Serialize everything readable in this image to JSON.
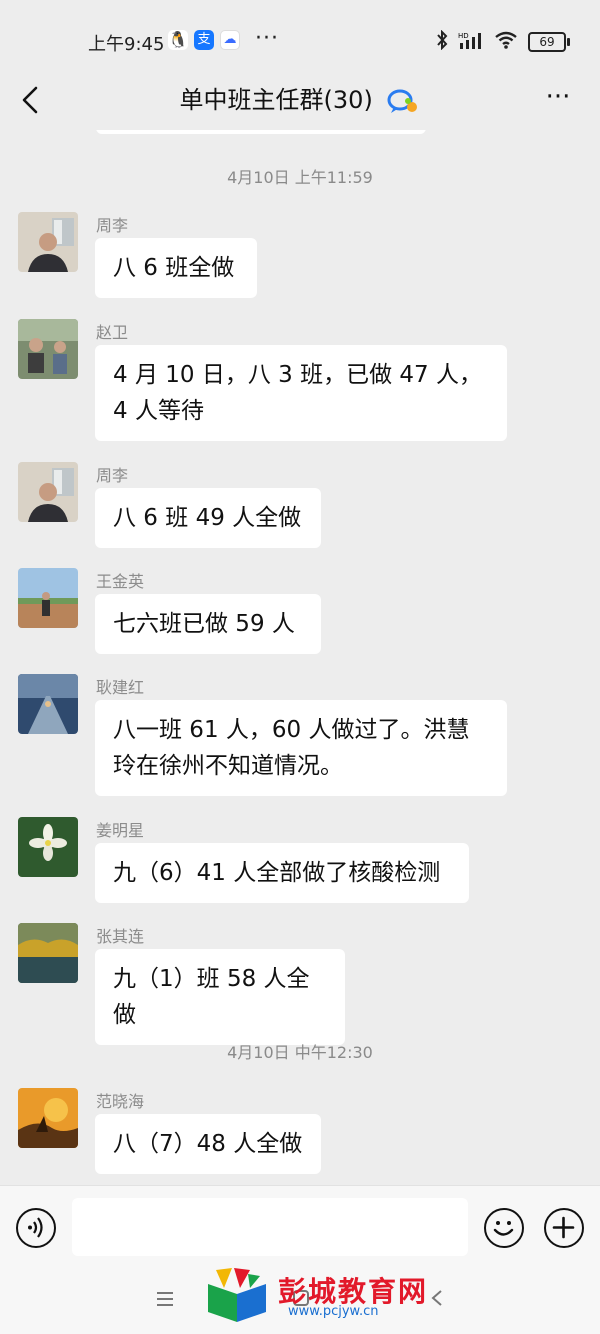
{
  "status_bar": {
    "time": "上午9:45",
    "battery": "69",
    "more": "···",
    "net_label": "HD"
  },
  "header": {
    "title": "单中班主任群(30)",
    "more": "···"
  },
  "timestamps": [
    "4月10日 上午11:59",
    "4月10日 中午12:30"
  ],
  "messages": [
    {
      "sender": "周李",
      "text": "八 6 班全做"
    },
    {
      "sender": "赵卫",
      "text": "4 月 10 日，八 3 班，已做 47 人，4 人等待"
    },
    {
      "sender": "周李",
      "text": "八 6 班 49 人全做"
    },
    {
      "sender": "王金英",
      "text": "七六班已做 59 人"
    },
    {
      "sender": "耿建红",
      "text": "八一班 61 人，60 人做过了。洪慧玲在徐州不知道情况。"
    },
    {
      "sender": "姜明星",
      "text": "九（6）41 人全部做了核酸检测"
    },
    {
      "sender": "张其连",
      "text": "九（1）班 58 人全做"
    },
    {
      "sender": "范晓海",
      "text": "八（7）48 人全做"
    }
  ],
  "input": {
    "placeholder": ""
  },
  "watermark": {
    "text": "彭城教育网",
    "url": "www.pcjyw.cn"
  },
  "colors": {
    "background": "#ededed",
    "bubble": "#ffffff",
    "timestamp": "#8a8a8a",
    "watermark": "#e2192a"
  }
}
